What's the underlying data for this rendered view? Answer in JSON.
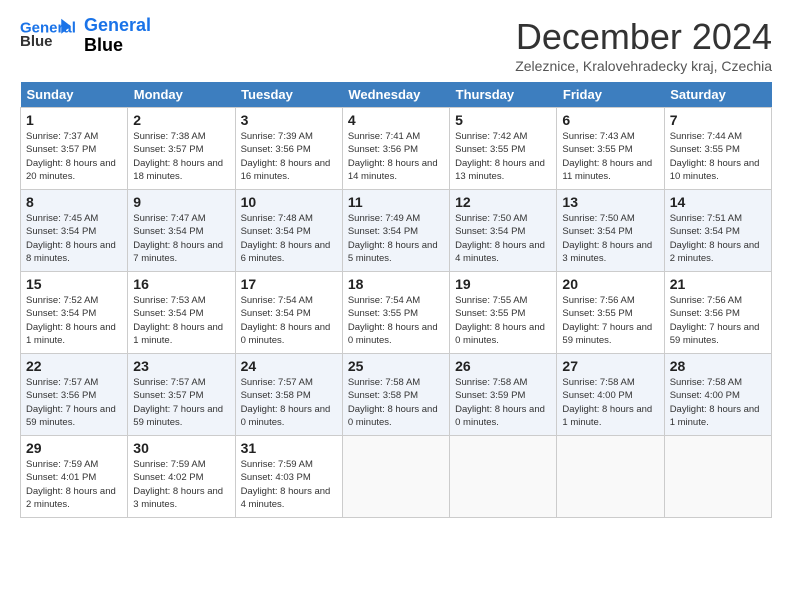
{
  "header": {
    "logo_line1": "General",
    "logo_line2": "Blue",
    "title": "December 2024",
    "location": "Zeleznice, Kralovehradecky kraj, Czechia"
  },
  "days_of_week": [
    "Sunday",
    "Monday",
    "Tuesday",
    "Wednesday",
    "Thursday",
    "Friday",
    "Saturday"
  ],
  "weeks": [
    [
      {
        "day": "1",
        "rise": "7:37 AM",
        "set": "3:57 PM",
        "daylight": "8 hours and 20 minutes."
      },
      {
        "day": "2",
        "rise": "7:38 AM",
        "set": "3:57 PM",
        "daylight": "8 hours and 18 minutes."
      },
      {
        "day": "3",
        "rise": "7:39 AM",
        "set": "3:56 PM",
        "daylight": "8 hours and 16 minutes."
      },
      {
        "day": "4",
        "rise": "7:41 AM",
        "set": "3:56 PM",
        "daylight": "8 hours and 14 minutes."
      },
      {
        "day": "5",
        "rise": "7:42 AM",
        "set": "3:55 PM",
        "daylight": "8 hours and 13 minutes."
      },
      {
        "day": "6",
        "rise": "7:43 AM",
        "set": "3:55 PM",
        "daylight": "8 hours and 11 minutes."
      },
      {
        "day": "7",
        "rise": "7:44 AM",
        "set": "3:55 PM",
        "daylight": "8 hours and 10 minutes."
      }
    ],
    [
      {
        "day": "8",
        "rise": "7:45 AM",
        "set": "3:54 PM",
        "daylight": "8 hours and 8 minutes."
      },
      {
        "day": "9",
        "rise": "7:47 AM",
        "set": "3:54 PM",
        "daylight": "8 hours and 7 minutes."
      },
      {
        "day": "10",
        "rise": "7:48 AM",
        "set": "3:54 PM",
        "daylight": "8 hours and 6 minutes."
      },
      {
        "day": "11",
        "rise": "7:49 AM",
        "set": "3:54 PM",
        "daylight": "8 hours and 5 minutes."
      },
      {
        "day": "12",
        "rise": "7:50 AM",
        "set": "3:54 PM",
        "daylight": "8 hours and 4 minutes."
      },
      {
        "day": "13",
        "rise": "7:50 AM",
        "set": "3:54 PM",
        "daylight": "8 hours and 3 minutes."
      },
      {
        "day": "14",
        "rise": "7:51 AM",
        "set": "3:54 PM",
        "daylight": "8 hours and 2 minutes."
      }
    ],
    [
      {
        "day": "15",
        "rise": "7:52 AM",
        "set": "3:54 PM",
        "daylight": "8 hours and 1 minute."
      },
      {
        "day": "16",
        "rise": "7:53 AM",
        "set": "3:54 PM",
        "daylight": "8 hours and 1 minute."
      },
      {
        "day": "17",
        "rise": "7:54 AM",
        "set": "3:54 PM",
        "daylight": "8 hours and 0 minutes."
      },
      {
        "day": "18",
        "rise": "7:54 AM",
        "set": "3:55 PM",
        "daylight": "8 hours and 0 minutes."
      },
      {
        "day": "19",
        "rise": "7:55 AM",
        "set": "3:55 PM",
        "daylight": "8 hours and 0 minutes."
      },
      {
        "day": "20",
        "rise": "7:56 AM",
        "set": "3:55 PM",
        "daylight": "7 hours and 59 minutes."
      },
      {
        "day": "21",
        "rise": "7:56 AM",
        "set": "3:56 PM",
        "daylight": "7 hours and 59 minutes."
      }
    ],
    [
      {
        "day": "22",
        "rise": "7:57 AM",
        "set": "3:56 PM",
        "daylight": "7 hours and 59 minutes."
      },
      {
        "day": "23",
        "rise": "7:57 AM",
        "set": "3:57 PM",
        "daylight": "7 hours and 59 minutes."
      },
      {
        "day": "24",
        "rise": "7:57 AM",
        "set": "3:58 PM",
        "daylight": "8 hours and 0 minutes."
      },
      {
        "day": "25",
        "rise": "7:58 AM",
        "set": "3:58 PM",
        "daylight": "8 hours and 0 minutes."
      },
      {
        "day": "26",
        "rise": "7:58 AM",
        "set": "3:59 PM",
        "daylight": "8 hours and 0 minutes."
      },
      {
        "day": "27",
        "rise": "7:58 AM",
        "set": "4:00 PM",
        "daylight": "8 hours and 1 minute."
      },
      {
        "day": "28",
        "rise": "7:58 AM",
        "set": "4:00 PM",
        "daylight": "8 hours and 1 minute."
      }
    ],
    [
      {
        "day": "29",
        "rise": "7:59 AM",
        "set": "4:01 PM",
        "daylight": "8 hours and 2 minutes."
      },
      {
        "day": "30",
        "rise": "7:59 AM",
        "set": "4:02 PM",
        "daylight": "8 hours and 3 minutes."
      },
      {
        "day": "31",
        "rise": "7:59 AM",
        "set": "4:03 PM",
        "daylight": "8 hours and 4 minutes."
      },
      null,
      null,
      null,
      null
    ]
  ]
}
